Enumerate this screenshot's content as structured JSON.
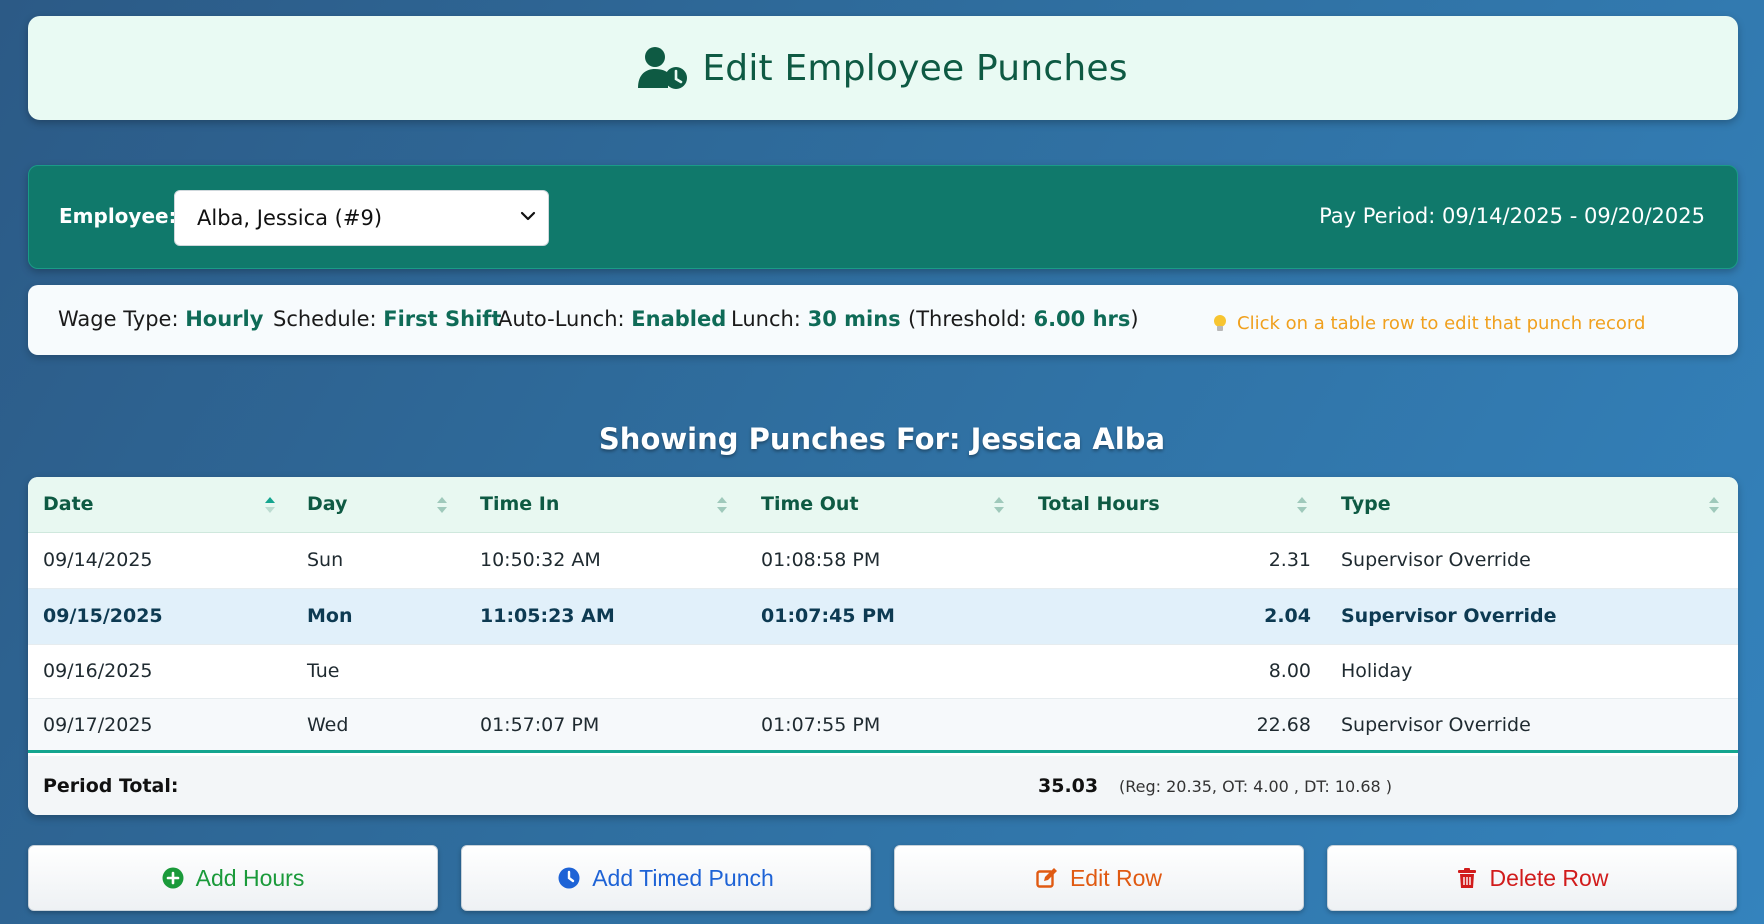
{
  "header": {
    "title": "Edit Employee Punches",
    "icon": "user-clock-icon"
  },
  "employee_bar": {
    "label": "Employee:",
    "selected": "Alba, Jessica (#9)",
    "pay_period": "Pay Period: 09/14/2025 - 09/20/2025"
  },
  "info": {
    "wage_label": "Wage Type:",
    "wage_value": "Hourly",
    "schedule_label": "Schedule:",
    "schedule_value": "First Shift",
    "autolunch_label": "Auto-Lunch:",
    "autolunch_value": "Enabled",
    "lunch_label": "Lunch:",
    "lunch_value": "30 mins",
    "threshold_prefix": "(Threshold:",
    "threshold_value": "6.00 hrs",
    "threshold_suffix": ")",
    "hint": "Click on a table row to edit that punch record",
    "hint_icon": "lightbulb-icon"
  },
  "showing": "Showing Punches For: Jessica Alba",
  "table": {
    "headers": [
      "Date",
      "Day",
      "Time In",
      "Time Out",
      "Total Hours",
      "Type"
    ],
    "rows": [
      [
        "09/14/2025",
        "Sun",
        "10:50:32 AM",
        "01:08:58 PM",
        "2.31",
        "Supervisor Override"
      ],
      [
        "09/15/2025",
        "Mon",
        "11:05:23 AM",
        "01:07:45 PM",
        "2.04",
        "Supervisor Override"
      ],
      [
        "09/16/2025",
        "Tue",
        "",
        "",
        "8.00",
        "Holiday"
      ],
      [
        "09/17/2025",
        "Wed",
        "01:57:07 PM",
        "01:07:55 PM",
        "22.68",
        "Supervisor Override"
      ]
    ],
    "footer": {
      "label": "Period Total:",
      "total": "35.03",
      "breakdown": "(Reg: 20.35, OT: 4.00 , DT: 10.68 )"
    }
  },
  "buttons": {
    "add_hours": "Add Hours",
    "add_timed_punch": "Add Timed Punch",
    "edit_row": "Edit Row",
    "delete_row": "Delete Row"
  },
  "colors": {
    "title_green": "#0e5a43",
    "bar_teal": "#10796b",
    "accent_value": "#0f6b57",
    "hint_orange": "#f0a01e",
    "add_hours": "#1a9a3a",
    "add_timed_punch": "#1e63d6",
    "edit_row": "#e05a12",
    "delete_row": "#d11c1c"
  }
}
